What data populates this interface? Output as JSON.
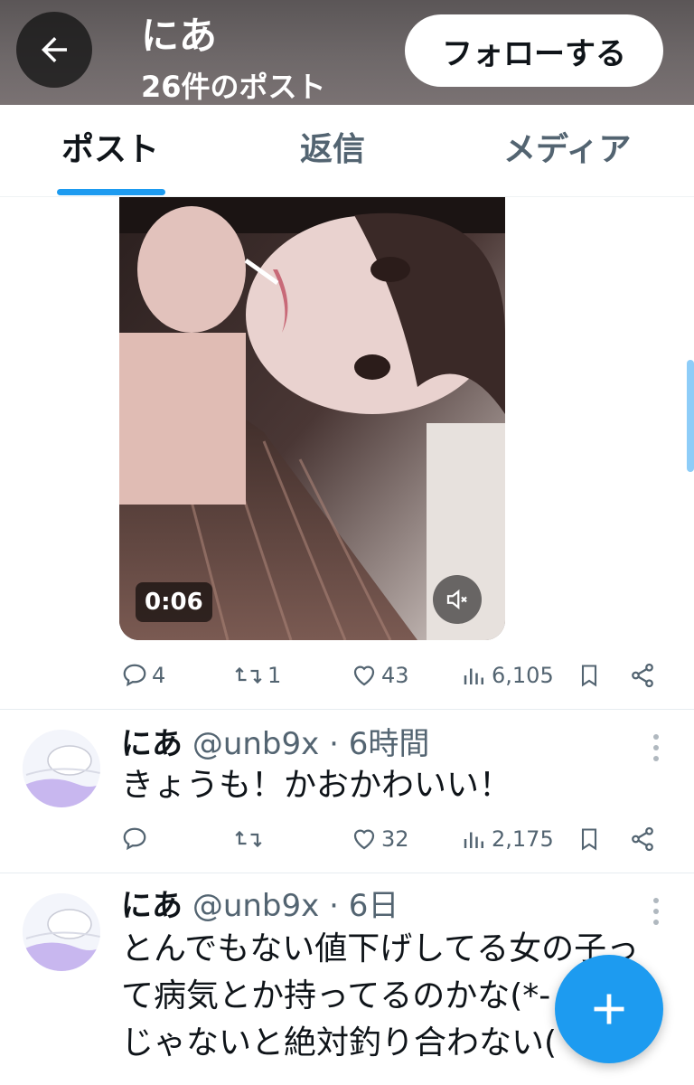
{
  "header": {
    "title": "にあ",
    "subtitle": "26件のポスト",
    "follow_label": "フォローする"
  },
  "tabs": [
    {
      "label": "ポスト",
      "active": true
    },
    {
      "label": "返信",
      "active": false
    },
    {
      "label": "メディア",
      "active": false
    }
  ],
  "media_post": {
    "video_duration": "0:06",
    "replies": "4",
    "reposts": "1",
    "likes": "43",
    "views": "6,105"
  },
  "tweets": [
    {
      "name": "にあ",
      "handle": "@unb9x",
      "separator": "·",
      "time": "6時間",
      "text": "きょうも！かおかわいい！",
      "replies": "",
      "reposts": "",
      "likes": "32",
      "views": "2,175"
    },
    {
      "name": "にあ",
      "handle": "@unb9x",
      "separator": "·",
      "time": "6日",
      "text_lines": [
        "とんでもない値下げしてる女の子っ",
        "て病気とか持ってるのかな(*-",
        "じゃないと絶対釣り合わない("
      ]
    }
  ],
  "colors": {
    "accent": "#1d9bf0",
    "text_primary": "#0f1419",
    "text_secondary": "#536471"
  },
  "icons": [
    "back-arrow-icon",
    "mute-icon",
    "reply-icon",
    "repost-icon",
    "like-icon",
    "views-icon",
    "bookmark-icon",
    "share-icon",
    "more-icon",
    "compose-plus-icon"
  ]
}
